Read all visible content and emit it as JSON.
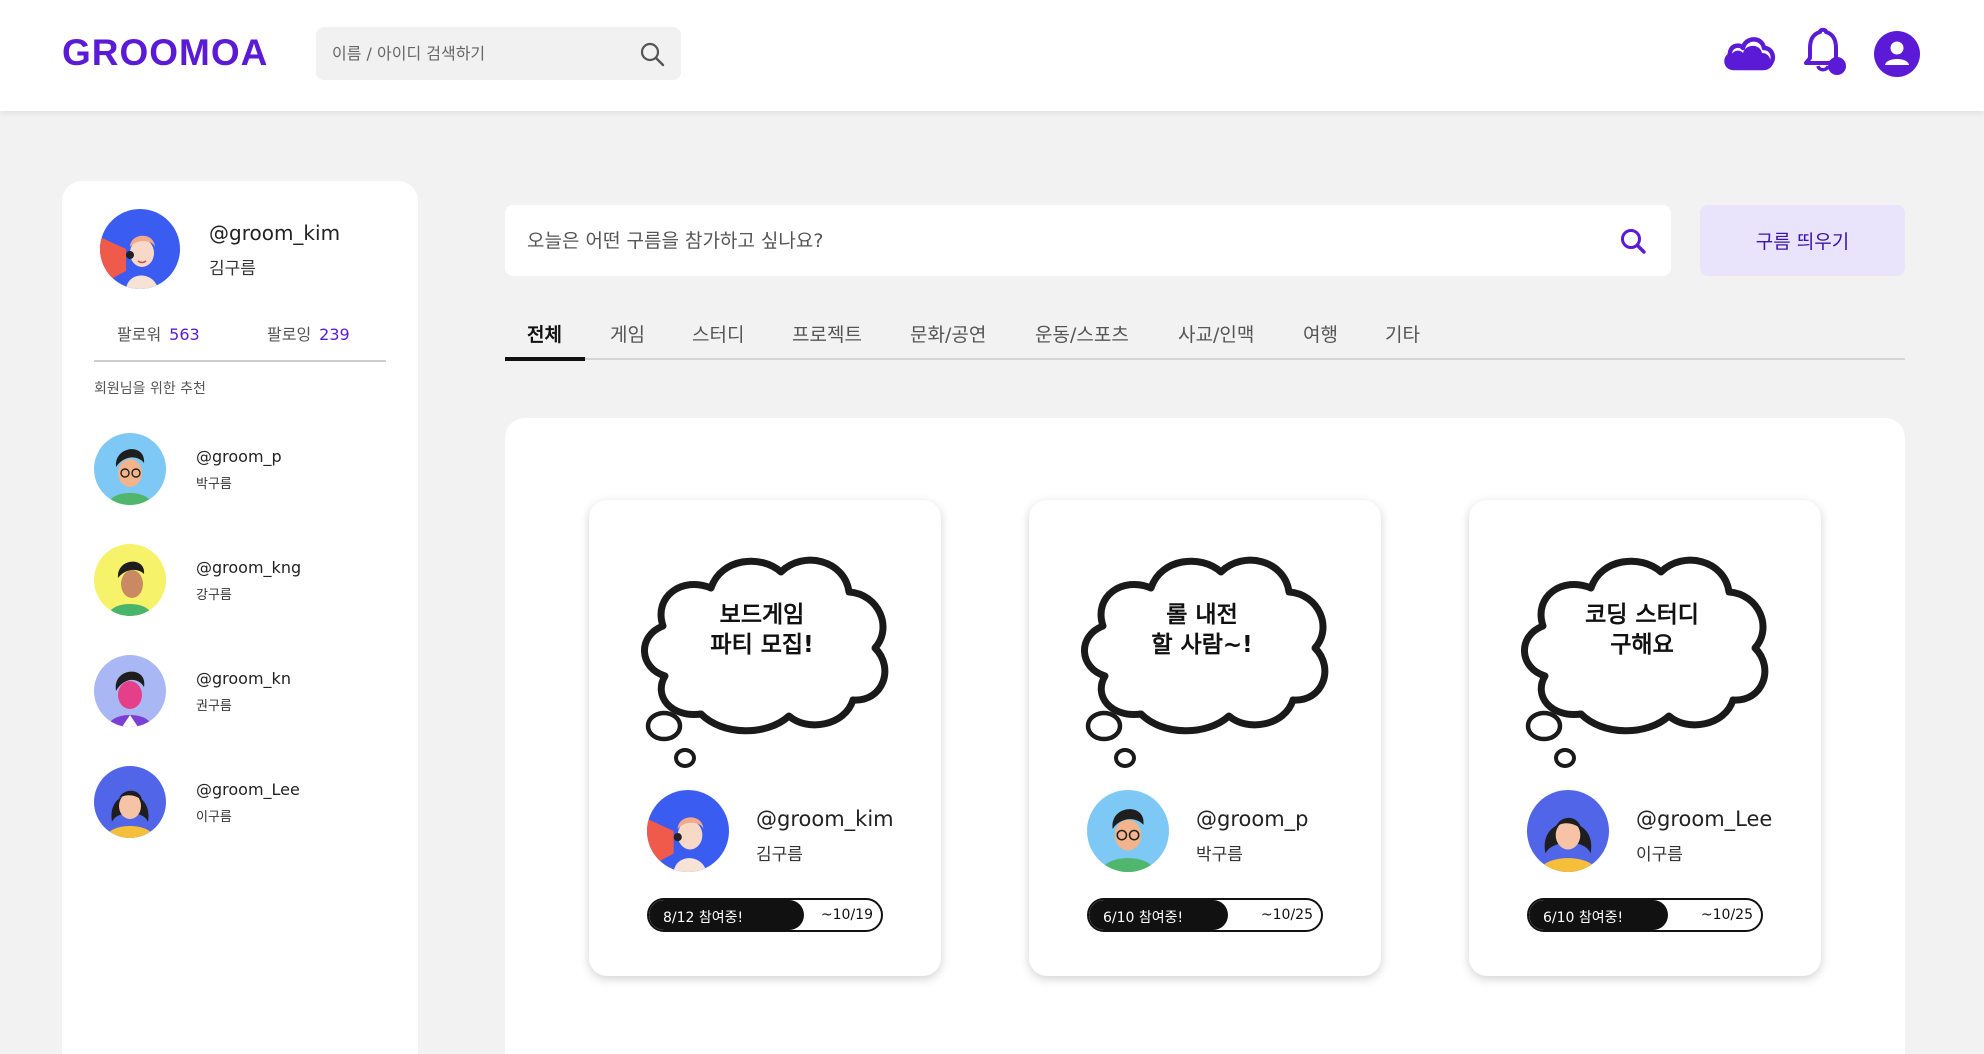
{
  "header": {
    "logo": "GROOMOA",
    "search_placeholder": "이름 / 아이디 검색하기",
    "icons": [
      "cloud-icon",
      "bell-icon",
      "profile-icon"
    ],
    "brand_color": "#5a1ad6"
  },
  "sidebar": {
    "me": {
      "id": "@groom_kim",
      "name": "김구름"
    },
    "followers_label": "팔로워",
    "followers_count": "563",
    "following_label": "팔로잉",
    "following_count": "239",
    "recommend_title": "회원님을 위한 추천",
    "recommendations": [
      {
        "id": "@groom_p",
        "name": "박구름"
      },
      {
        "id": "@groom_kng",
        "name": "강구름"
      },
      {
        "id": "@groom_kn",
        "name": "권구름"
      },
      {
        "id": "@groom_Lee",
        "name": "이구름"
      }
    ]
  },
  "main": {
    "search_placeholder": "오늘은 어떤 구름을 참가하고 싶나요?",
    "create_button": "구름 띄우기",
    "tabs": [
      "전체",
      "게임",
      "스터디",
      "프로젝트",
      "문화/공연",
      "운동/스포츠",
      "사교/인맥",
      "여행",
      "기타"
    ],
    "active_tab": "전체",
    "cards": [
      {
        "line1": "보드게임",
        "line2": "파티 모집!",
        "user_id": "@groom_kim",
        "user_name": "김구름",
        "status": "8/12 참여중!",
        "joined": 8,
        "capacity": 12,
        "deadline": "~10/19"
      },
      {
        "line1": "롤 내전",
        "line2": "할 사람~!",
        "user_id": "@groom_p",
        "user_name": "박구름",
        "status": "6/10 참여중!",
        "joined": 6,
        "capacity": 10,
        "deadline": "~10/25"
      },
      {
        "line1": "코딩 스터디",
        "line2": "구해요",
        "user_id": "@groom_Lee",
        "user_name": "이구름",
        "status": "6/10 참여중!",
        "joined": 6,
        "capacity": 10,
        "deadline": "~10/25"
      }
    ]
  }
}
